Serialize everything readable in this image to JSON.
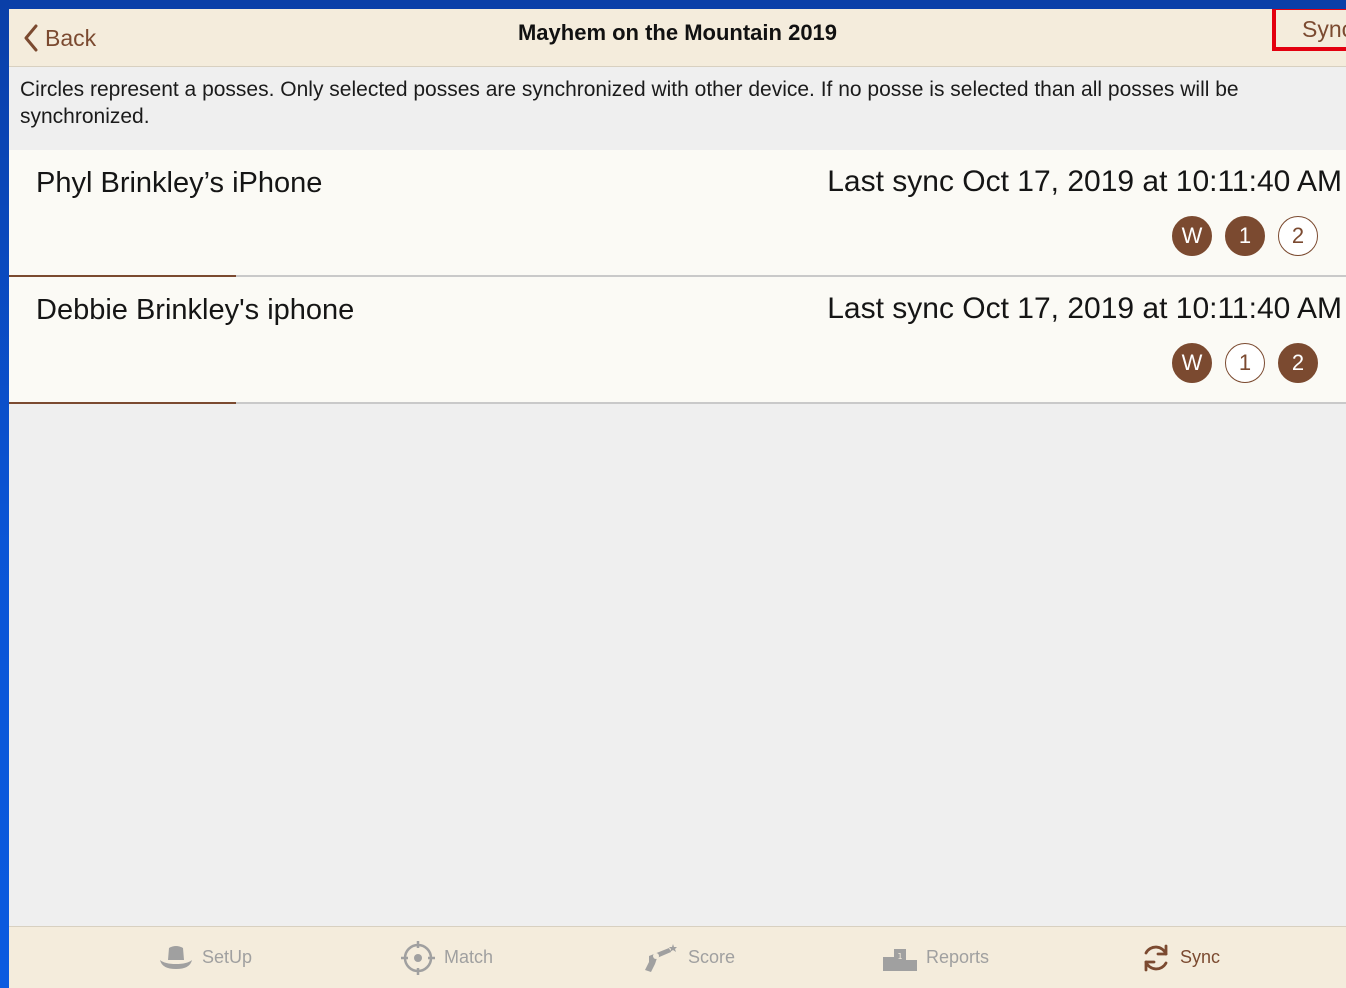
{
  "navbar": {
    "back_label": "Back",
    "title": "Mayhem on the Mountain 2019",
    "sync_label": "Sync"
  },
  "info_text": "Circles represent a posses. Only selected posses are synchronized with other device. If no posse is selected than all posses will be synchronized.",
  "devices": [
    {
      "name": "Phyl Brinkley’s iPhone",
      "last_sync": "Last sync Oct 17, 2019 at 10:11:40 AM",
      "posses": [
        {
          "label": "W",
          "selected": true
        },
        {
          "label": "1",
          "selected": true
        },
        {
          "label": "2",
          "selected": false
        }
      ]
    },
    {
      "name": "Debbie Brinkley's iphone",
      "last_sync": "Last sync Oct 17, 2019 at 10:11:40 AM",
      "posses": [
        {
          "label": "W",
          "selected": true
        },
        {
          "label": "1",
          "selected": false
        },
        {
          "label": "2",
          "selected": true
        }
      ]
    }
  ],
  "tabs": [
    {
      "label": "SetUp",
      "icon": "cowboy-hat-icon",
      "active": false
    },
    {
      "label": "Match",
      "icon": "crosshair-icon",
      "active": false
    },
    {
      "label": "Score",
      "icon": "revolver-icon",
      "active": false
    },
    {
      "label": "Reports",
      "icon": "podium-icon",
      "active": false
    },
    {
      "label": "Sync",
      "icon": "sync-arrows-icon",
      "active": true
    }
  ],
  "colors": {
    "accent": "#7b4a30",
    "bar_background": "#f4ecdc",
    "highlight_box": "#e3000f",
    "desktop_background": "#0b55d6"
  }
}
